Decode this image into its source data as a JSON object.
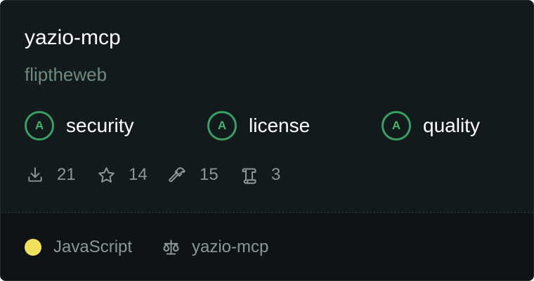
{
  "package": {
    "name": "yazio-mcp",
    "owner": "fliptheweb"
  },
  "scores": [
    {
      "grade": "A",
      "label": "security"
    },
    {
      "grade": "A",
      "label": "license"
    },
    {
      "grade": "A",
      "label": "quality"
    }
  ],
  "stats": {
    "downloads": "21",
    "stars": "14",
    "tools": "15",
    "readme": "3"
  },
  "footer": {
    "language": "JavaScript",
    "language_color": "#f1e05a",
    "license": "yazio-mcp"
  },
  "icons": {
    "downloads": "download-icon",
    "stars": "star-icon",
    "tools": "hammer-icon",
    "readme": "scroll-icon",
    "license": "scale-icon"
  },
  "colors": {
    "background": "#131a1c",
    "footer_background": "#0e1416",
    "grade_accent": "#3a9d64",
    "owner_text": "#6f8a7e",
    "muted_text": "#8d9597"
  }
}
